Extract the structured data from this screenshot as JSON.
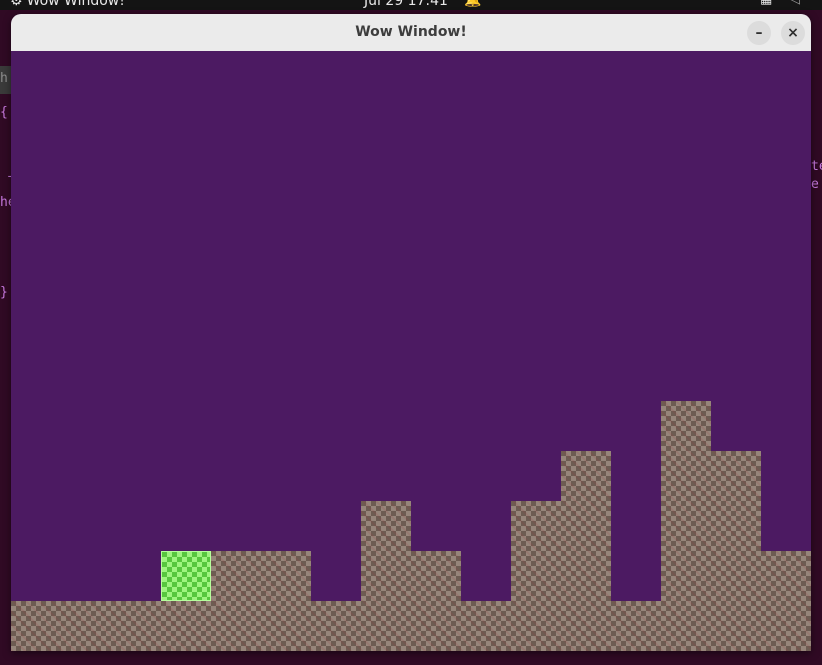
{
  "topbar": {
    "app_name": "Wow Window!",
    "clock": "Jul 29  17:41"
  },
  "terminal_fragments": {
    "h": "h",
    "brace_open": "{",
    "dash": "-",
    "he": "he",
    "brace_close": "}",
    "te": "te",
    "e": "e"
  },
  "window": {
    "title": "Wow Window!",
    "minimize_label": "–",
    "close_label": "×"
  },
  "game": {
    "background_color": "#4c1a62",
    "tile_size": 50,
    "player_color": "#7ce660",
    "player": {
      "col": 3,
      "row": 10
    },
    "terrain": [
      {
        "col": 0,
        "height": 1
      },
      {
        "col": 1,
        "height": 1
      },
      {
        "col": 2,
        "height": 1
      },
      {
        "col": 3,
        "height": 1
      },
      {
        "col": 4,
        "height": 2
      },
      {
        "col": 5,
        "height": 2
      },
      {
        "col": 6,
        "height": 1
      },
      {
        "col": 7,
        "height": 3
      },
      {
        "col": 8,
        "height": 2
      },
      {
        "col": 9,
        "height": 1
      },
      {
        "col": 10,
        "height": 3
      },
      {
        "col": 11,
        "height": 4
      },
      {
        "col": 12,
        "height": 1
      },
      {
        "col": 13,
        "height": 5
      },
      {
        "col": 14,
        "height": 4
      },
      {
        "col": 15,
        "height": 2
      }
    ]
  }
}
